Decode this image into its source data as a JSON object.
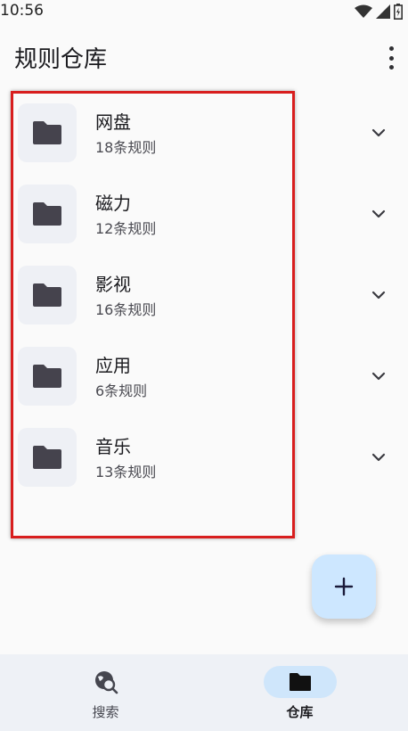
{
  "status_bar": {
    "time": "10:56"
  },
  "app_bar": {
    "title": "规则仓库"
  },
  "folders": [
    {
      "name": "网盘",
      "count": "18条规则"
    },
    {
      "name": "磁力",
      "count": "12条规则"
    },
    {
      "name": "影视",
      "count": "16条规则"
    },
    {
      "name": "应用",
      "count": "6条规则"
    },
    {
      "name": "音乐",
      "count": "13条规则"
    }
  ],
  "bottom_nav": {
    "items": [
      {
        "label": "搜索",
        "icon": "search-globe-icon",
        "active": false
      },
      {
        "label": "仓库",
        "icon": "folder-icon",
        "active": true
      }
    ]
  },
  "colors": {
    "accent": "#cde7ff",
    "highlight_border": "#d81e1e",
    "folder_icon": "#45434d"
  }
}
